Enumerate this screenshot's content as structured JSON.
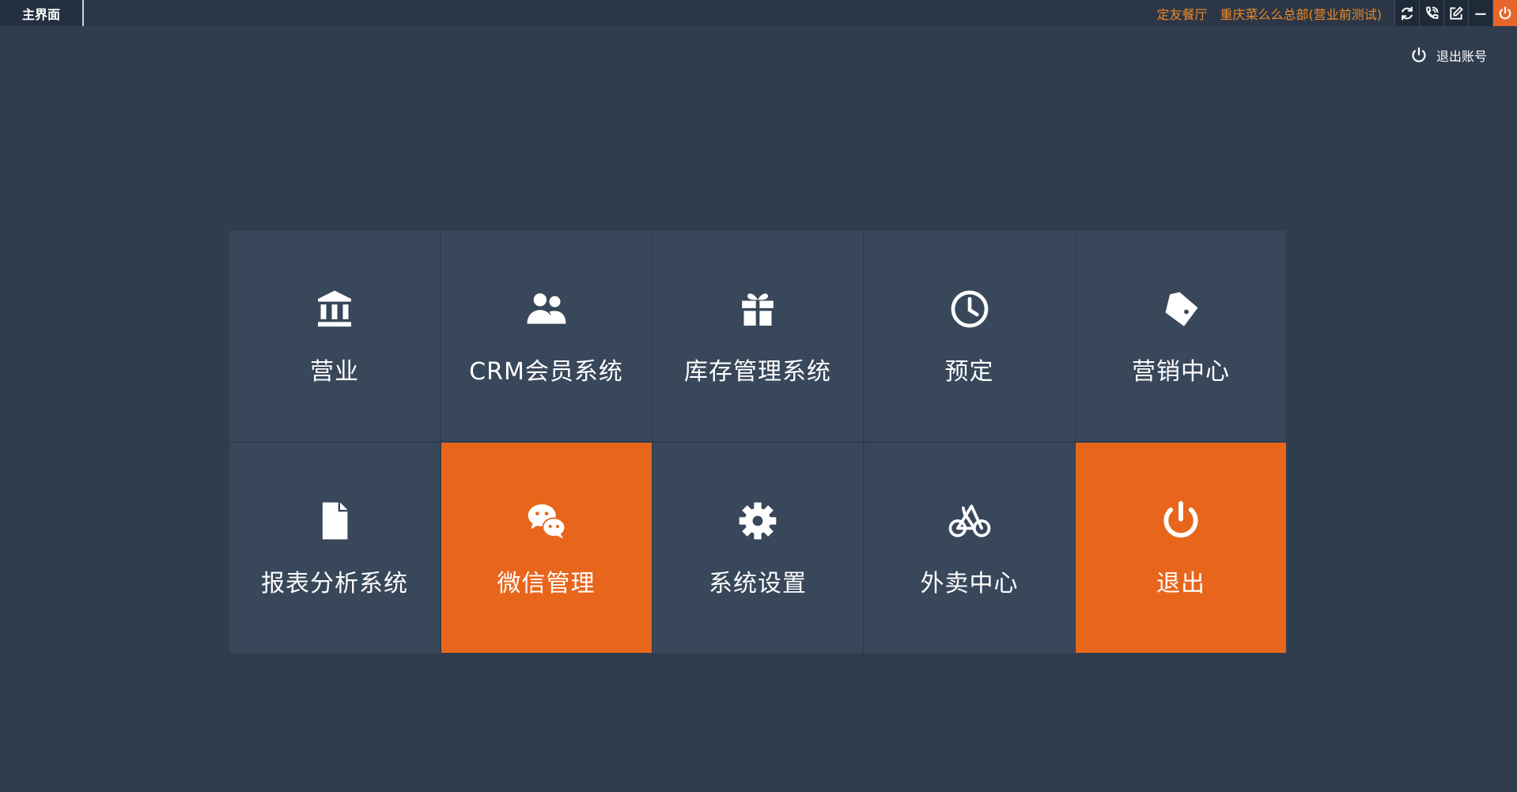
{
  "titlebar": {
    "tab": "主界面",
    "restaurant": "定友餐厅",
    "store": "重庆菜么么总部(营业前测试)",
    "buttons": [
      {
        "name": "refresh-icon"
      },
      {
        "name": "phone-icon"
      },
      {
        "name": "edit-icon"
      },
      {
        "name": "minimize-icon"
      },
      {
        "name": "power-icon"
      }
    ]
  },
  "account": {
    "logout_label": "退出账号"
  },
  "tiles": [
    {
      "label": "营业",
      "icon": "bank-icon",
      "accent": false
    },
    {
      "label": "CRM会员系统",
      "icon": "users-icon",
      "accent": false
    },
    {
      "label": "库存管理系统",
      "icon": "gift-icon",
      "accent": false
    },
    {
      "label": "预定",
      "icon": "clock-icon",
      "accent": false
    },
    {
      "label": "营销中心",
      "icon": "tag-icon",
      "accent": false
    },
    {
      "label": "报表分析系统",
      "icon": "document-icon",
      "accent": false
    },
    {
      "label": "微信管理",
      "icon": "wechat-icon",
      "accent": true
    },
    {
      "label": "系统设置",
      "icon": "gear-icon",
      "accent": false
    },
    {
      "label": "外卖中心",
      "icon": "bicycle-icon",
      "accent": false
    },
    {
      "label": "退出",
      "icon": "power-icon",
      "accent": true
    }
  ],
  "colors": {
    "background": "#2f3d4f",
    "tile": "#38475a",
    "accent": "#e8661c",
    "titlebar_text": "#f08a24"
  }
}
